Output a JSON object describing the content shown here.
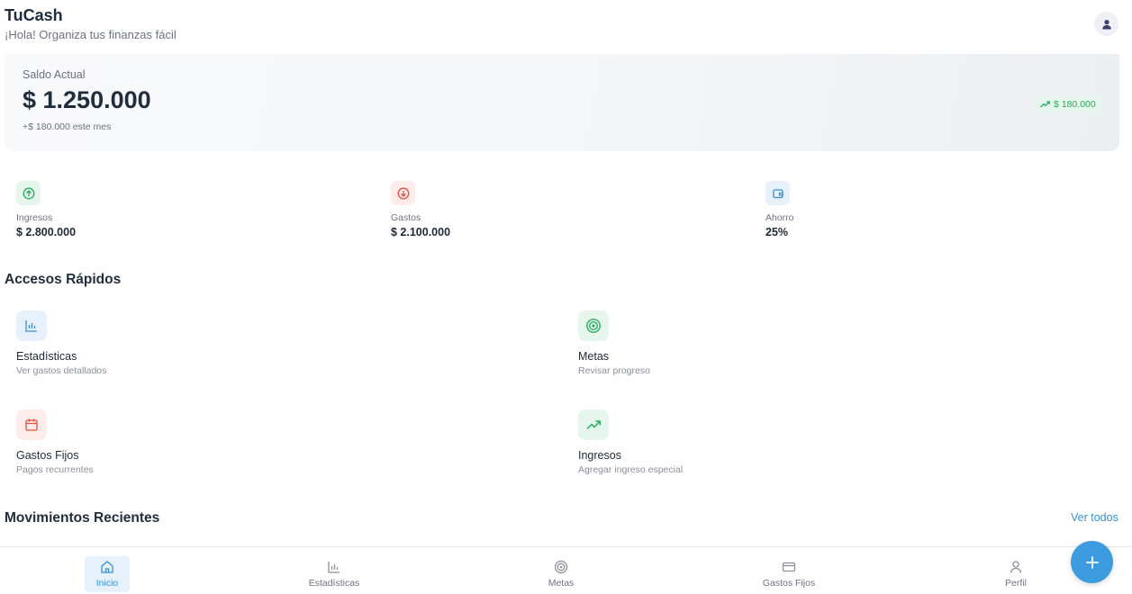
{
  "header": {
    "title": "TuCash",
    "subtitle": "¡Hola! Organiza tus finanzas fácil",
    "avatar_icon": "user-icon"
  },
  "balance": {
    "label": "Saldo Actual",
    "value": "$ 1.250.000",
    "note": "+$ 180.000 este mes",
    "badge": "$ 180.000",
    "badge_icon": "trending-up-icon"
  },
  "stats": [
    {
      "label": "Ingresos",
      "value": "$ 2.800.000",
      "icon": "arrow-up-circle-icon",
      "color": "#27ae60"
    },
    {
      "label": "Gastos",
      "value": "$ 2.100.000",
      "icon": "arrow-down-circle-icon",
      "color": "#e74c3c"
    },
    {
      "label": "Ahorro",
      "value": "25%",
      "icon": "wallet-icon",
      "color": "#3a8fd6"
    }
  ],
  "quick_access": {
    "title": "Accesos Rápidos",
    "items": [
      {
        "title": "Estadísticas",
        "subtitle": "Ver gastos detallados",
        "icon": "bar-chart-icon"
      },
      {
        "title": "Metas",
        "subtitle": "Revisar progreso",
        "icon": "target-icon"
      },
      {
        "title": "Gastos Fijos",
        "subtitle": "Pagos recurrentes",
        "icon": "calendar-icon"
      },
      {
        "title": "Ingresos",
        "subtitle": "Agregar ingreso especial",
        "icon": "trending-up-icon"
      }
    ]
  },
  "recent": {
    "title": "Movimientos Recientes",
    "see_all": "Ver todos"
  },
  "nav": {
    "items": [
      {
        "label": "Inicio",
        "icon": "home-icon",
        "active": true
      },
      {
        "label": "Estadísticas",
        "icon": "bar-chart-icon",
        "active": false
      },
      {
        "label": "Metas",
        "icon": "target-icon",
        "active": false
      },
      {
        "label": "Gastos Fijos",
        "icon": "credit-card-icon",
        "active": false
      },
      {
        "label": "Perfil",
        "icon": "user-icon",
        "active": false
      }
    ],
    "fab_icon": "plus-icon"
  },
  "colors": {
    "accent": "#3a8fd6",
    "income": "#27ae60",
    "expense": "#e74c3c"
  }
}
